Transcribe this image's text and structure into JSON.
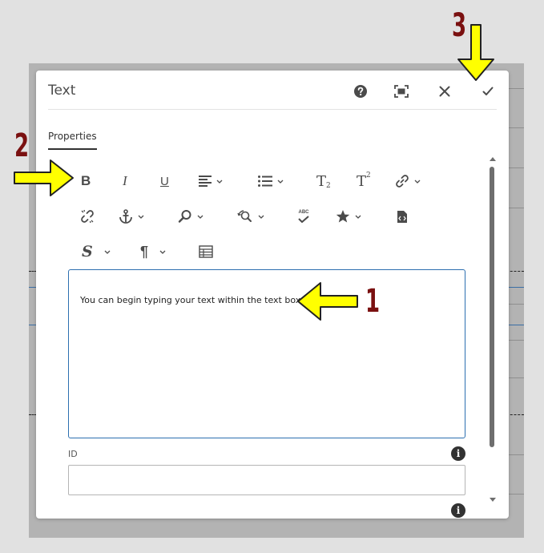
{
  "dialog": {
    "title": "Text",
    "tab_label": "Properties"
  },
  "header_buttons": [
    "help-icon",
    "fullscreen-icon",
    "close-icon",
    "checkmark-icon"
  ],
  "toolbar": {
    "rows": [
      [
        "bold",
        "italic",
        "underline",
        "align",
        "list",
        "subscript",
        "superscript",
        "link"
      ],
      [
        "unlink",
        "anchor",
        "find",
        "find-replace",
        "spellcheck",
        "special-characters",
        "source-edit"
      ],
      [
        "styles",
        "paragraph-format",
        "table"
      ]
    ],
    "labels": {
      "bold": "B",
      "italic": "I",
      "underline": "U",
      "styles": "S",
      "paragraph": "¶",
      "subscript_base": "T",
      "subscript_mark": "2",
      "superscript_base": "T",
      "superscript_mark": "2",
      "spellcheck": "ABC"
    }
  },
  "editor": {
    "text": "You can begin typing your text within the text box..."
  },
  "id_field": {
    "label": "ID",
    "value": ""
  },
  "annotations": {
    "one": "1",
    "two": "2",
    "three": "3"
  },
  "colors": {
    "accent_blue": "#2c6fb0",
    "annotation_red": "#7a1010",
    "arrow_yellow": "#ffff00"
  }
}
